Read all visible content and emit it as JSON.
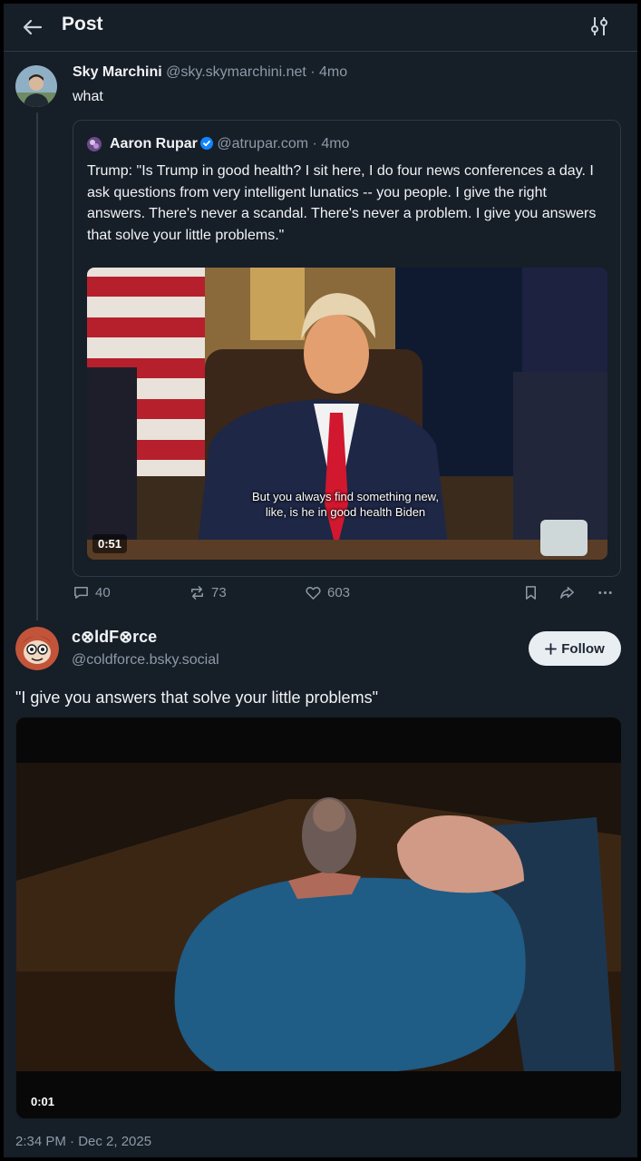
{
  "header": {
    "title": "Post",
    "back_icon": "arrow-left-icon",
    "settings_icon": "sliders-icon"
  },
  "parent_post": {
    "author_name": "Sky Marchini",
    "author_handle": "@sky.skymarchini.net",
    "separator": " · ",
    "time_ago": "4mo",
    "text": "what",
    "quote": {
      "author_name": "Aaron Rupar",
      "author_handle": "@atrupar.com",
      "time_ago": "4mo",
      "text": "Trump: \"Is Trump in good health? I sit here, I do four news conferences a day. I ask questions from very intelligent lunatics -- you people. I give the right answers. There's never a scandal. There's never a problem. I give you answers that solve your little problems.\"",
      "video": {
        "caption_line1": "But you always find something new,",
        "caption_line2": "like, is he in good health Biden",
        "duration": "0:51"
      }
    },
    "actions": {
      "replies": "40",
      "reposts": "73",
      "likes": "603"
    }
  },
  "reply_post": {
    "author_name": "c⊗ldF⊗rce",
    "author_handle": "@coldforce.bsky.social",
    "follow_label": "Follow",
    "text": "\"I give you answers that solve your little problems\"",
    "video": {
      "duration": "0:01"
    },
    "timestamp": "2:34 PM · Dec 2, 2025"
  },
  "colors": {
    "background": "#161e27",
    "border": "#2e3a47",
    "muted_text": "#8d9aa8",
    "verified_blue": "#1185fe"
  }
}
